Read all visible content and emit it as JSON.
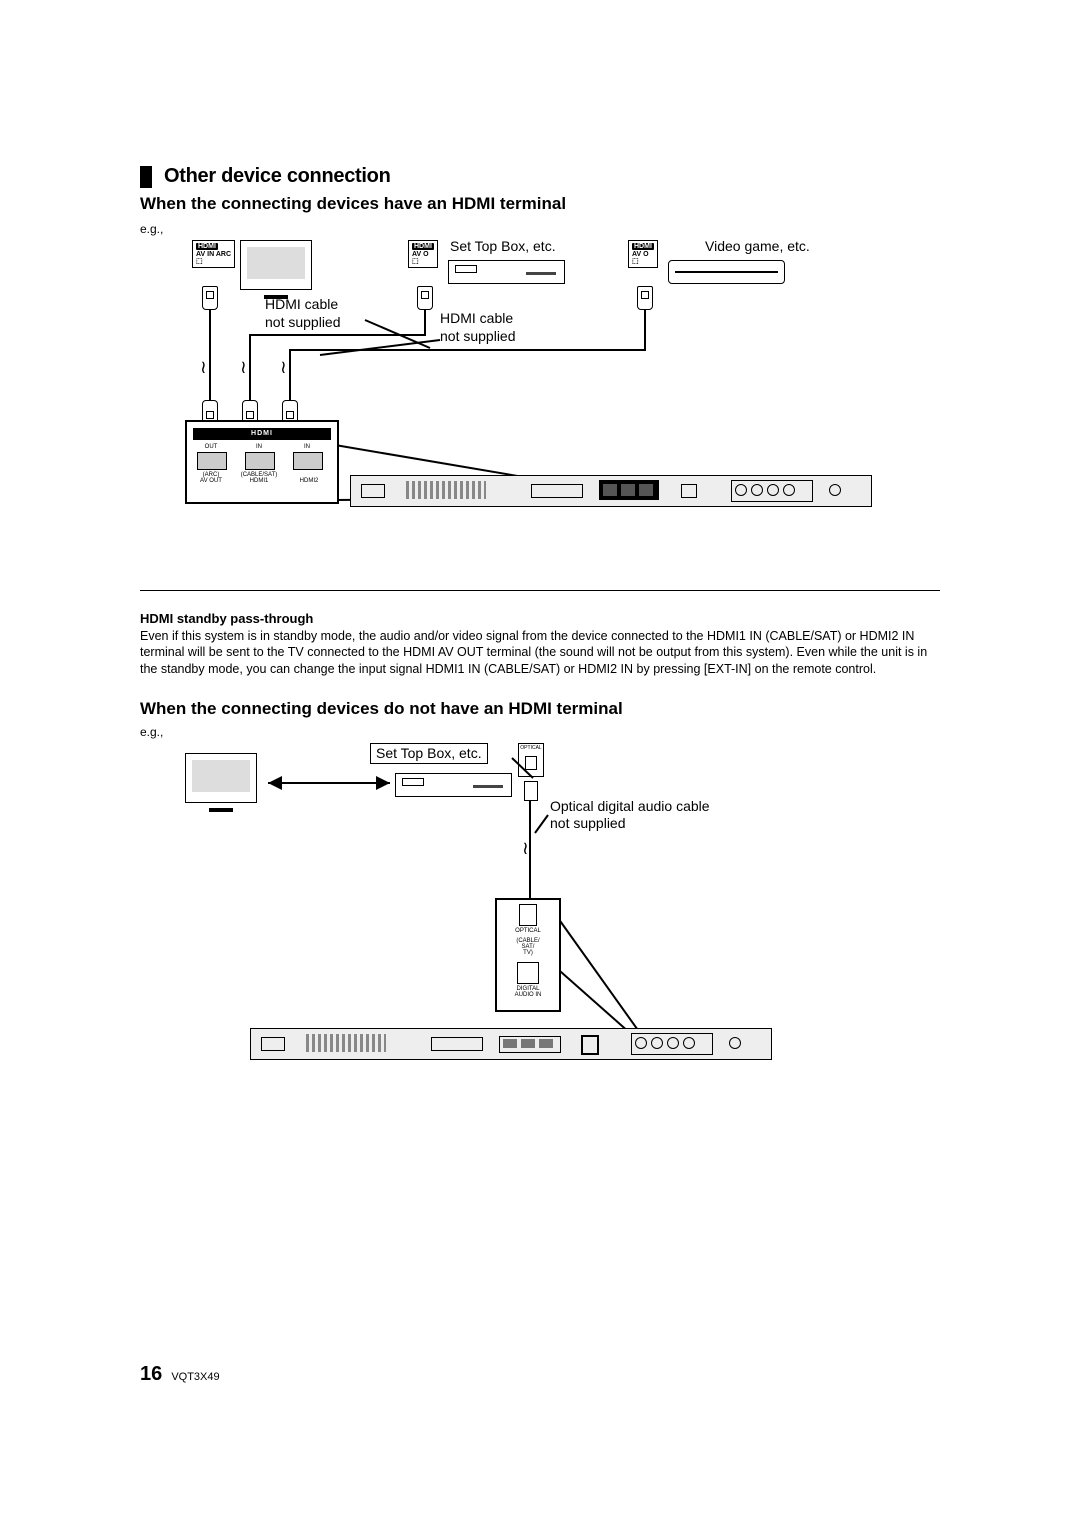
{
  "section_title": "Other device connection",
  "hdmi_section": {
    "title": "When the connecting devices have an HDMI terminal",
    "eg": "e.g.,",
    "labels": {
      "set_top_box": "Set Top Box, etc.",
      "video_game": "Video game, etc.",
      "hdmi_cable1": "HDMI cable\nnot supplied",
      "hdmi_cable2": "HDMI cable\nnot supplied"
    },
    "port_box": {
      "hdmi_word": "HDMI",
      "out": "OUT",
      "in": "IN",
      "arc": "(ARC)\nAV OUT",
      "cable_sat": "(CABLE/SAT)\nHDMI1",
      "hdmi2": "HDMI2"
    },
    "badges": {
      "tv": "AV IN\nARC",
      "stb": "AV O",
      "game": "AV O"
    }
  },
  "passthrough": {
    "title": "HDMI standby pass-through",
    "body": "Even if this system is in standby mode, the audio and/or video signal from the device connected to the HDMI1 IN (CABLE/SAT) or HDMI2 IN terminal will be sent to the TV connected to the HDMI AV OUT terminal (the sound will not be output from this system). Even while the unit is in the standby mode, you can change the input signal HDMI1 IN (CABLE/SAT) or HDMI2 IN by pressing [EXT-IN] on the remote control."
  },
  "nonhdmi_section": {
    "title": "When the connecting devices do not have an HDMI terminal",
    "eg": "e.g.,",
    "labels": {
      "set_top_box": "Set Top Box, etc.",
      "optical_cable": "Optical digital audio cable\nnot supplied"
    },
    "port_box": {
      "optical": "OPTICAL",
      "cable_sat_tv": "(CABLE/\nSAT/\nTV)",
      "digital_audio_in": "DIGITAL\nAUDIO IN"
    }
  },
  "footer": {
    "page": "16",
    "docid": "VQT3X49"
  }
}
